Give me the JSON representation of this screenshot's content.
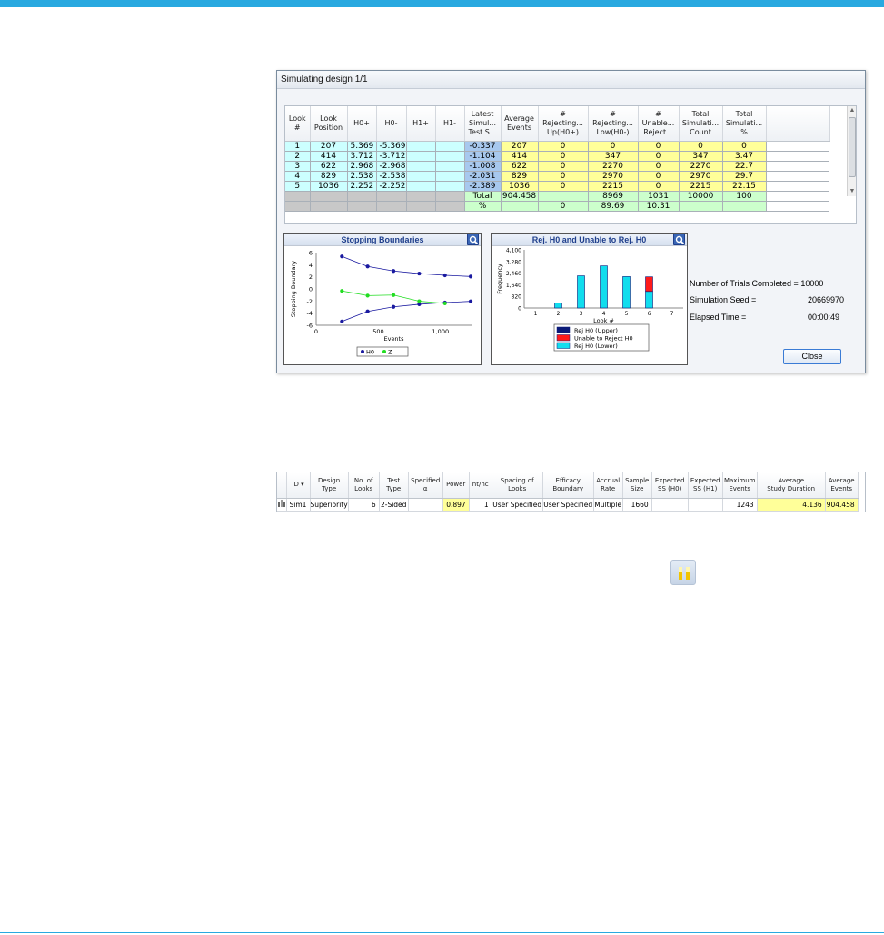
{
  "dialog": {
    "title": "Simulating design 1/1",
    "headers": [
      "Look\n#",
      "Look\nPosition",
      "H0+",
      "H0-",
      "H1+",
      "H1-",
      "Latest\nSimul...\nTest S...",
      "Average\nEvents",
      "#\nRejecting...\nUp(H0+)",
      "#\nRejecting...\nLow(H0-)",
      "#\nUnable...\nReject...",
      "Total\nSimulati...\nCount",
      "Total\nSimulati...\n%"
    ],
    "rows": [
      [
        "1",
        "207",
        "5.369",
        "-5.369",
        "",
        "",
        "-0.337",
        "207",
        "0",
        "0",
        "0",
        "0",
        "0"
      ],
      [
        "2",
        "414",
        "3.712",
        "-3.712",
        "",
        "",
        "-1.104",
        "414",
        "0",
        "347",
        "0",
        "347",
        "3.47"
      ],
      [
        "3",
        "622",
        "2.968",
        "-2.968",
        "",
        "",
        "-1.008",
        "622",
        "0",
        "2270",
        "0",
        "2270",
        "22.7"
      ],
      [
        "4",
        "829",
        "2.538",
        "-2.538",
        "",
        "",
        "-2.031",
        "829",
        "0",
        "2970",
        "0",
        "2970",
        "29.7"
      ],
      [
        "5",
        "1036",
        "2.252",
        "-2.252",
        "",
        "",
        "-2.389",
        "1036",
        "0",
        "2215",
        "0",
        "2215",
        "22.15"
      ]
    ],
    "total_row": [
      "Total",
      "904.458",
      "",
      "8969",
      "1031",
      "10000",
      "100"
    ],
    "pct_row": [
      "%",
      "",
      "0",
      "89.69",
      "10.31",
      "",
      ""
    ],
    "close_label": "Close",
    "stats": {
      "trials_label": "Number of Trials Completed =",
      "trials_value": "10000",
      "seed_label": "Simulation Seed =",
      "seed_value": "20669970",
      "elapsed_label": "Elapsed Time =",
      "elapsed_value": "00:00:49"
    }
  },
  "chart_data": [
    {
      "type": "line",
      "title": "Stopping Boundaries",
      "xlabel": "Events",
      "ylabel": "Stopping Boundary",
      "xlim": [
        0,
        1250
      ],
      "ylim": [
        -6,
        6
      ],
      "xticks": [
        "0",
        "500",
        "1,000"
      ],
      "yticks": [
        "6",
        "4",
        "2",
        "0",
        "-2",
        "-4",
        "-6"
      ],
      "legend": [
        "H0",
        "Z"
      ],
      "series": [
        {
          "name": "H0",
          "color": "#1a1aa0",
          "x": [
            207,
            414,
            622,
            829,
            1036,
            1243
          ],
          "y": [
            5.369,
            3.712,
            2.968,
            2.538,
            2.252,
            2.05
          ]
        },
        {
          "name": "H0",
          "color": "#1a1aa0",
          "x": [
            207,
            414,
            622,
            829,
            1036,
            1243
          ],
          "y": [
            -5.369,
            -3.712,
            -2.968,
            -2.538,
            -2.252,
            -2.05
          ]
        },
        {
          "name": "Z",
          "color": "#22dd22",
          "x": [
            207,
            414,
            622,
            829,
            1036
          ],
          "y": [
            -0.337,
            -1.104,
            -1.008,
            -2.031,
            -2.389
          ]
        }
      ]
    },
    {
      "type": "bar",
      "title": "Rej. H0 and Unable to Rej. H0",
      "xlabel": "Look #",
      "ylabel": "Frequency",
      "ylim": [
        0,
        4100
      ],
      "yticks": [
        "0",
        "820",
        "1,640",
        "2,460",
        "3,280",
        "4,100"
      ],
      "categories": [
        "1",
        "2",
        "3",
        "4",
        "5",
        "6",
        "7"
      ],
      "legend": [
        "Rej H0 (Upper)",
        "Unable to Reject H0",
        "Rej H0 (Lower)"
      ],
      "series": [
        {
          "name": "Rej H0 (Upper)",
          "color": "#0a1a78",
          "values": [
            0,
            0,
            0,
            0,
            0,
            0,
            0
          ]
        },
        {
          "name": "Unable to Reject H0",
          "color": "#ff1a1a",
          "values": [
            0,
            0,
            0,
            0,
            0,
            1031,
            0
          ]
        },
        {
          "name": "Rej H0 (Lower)",
          "color": "#11ddee",
          "values": [
            0,
            347,
            2270,
            2970,
            2215,
            1167,
            0
          ]
        }
      ]
    }
  ],
  "grid2": {
    "headers": [
      "ID",
      "Design\nType",
      "No. of\nLooks",
      "Test\nType",
      "Specified\nα",
      "Power",
      "nt/nc",
      "Spacing of\nLooks",
      "Efficacy\nBoundary",
      "Accrual\nRate",
      "Sample\nSize",
      "Expected\nSS (H0)",
      "Expected\nSS (H1)",
      "Maximum\nEvents",
      "Average\nStudy Duration",
      "Average\nEvents"
    ],
    "row": [
      "Sim1",
      "Superiority",
      "6",
      "2-Sided",
      "",
      "0.897",
      "1",
      "User Specified",
      "User Specified",
      "Multiple",
      "1660",
      "",
      "",
      "1243",
      "4.136",
      "904.458"
    ]
  },
  "colors": {
    "accent": "#29a9e0",
    "highlight": "#ffff99",
    "cyan": "#ccffff",
    "green": "#ccffcc"
  }
}
